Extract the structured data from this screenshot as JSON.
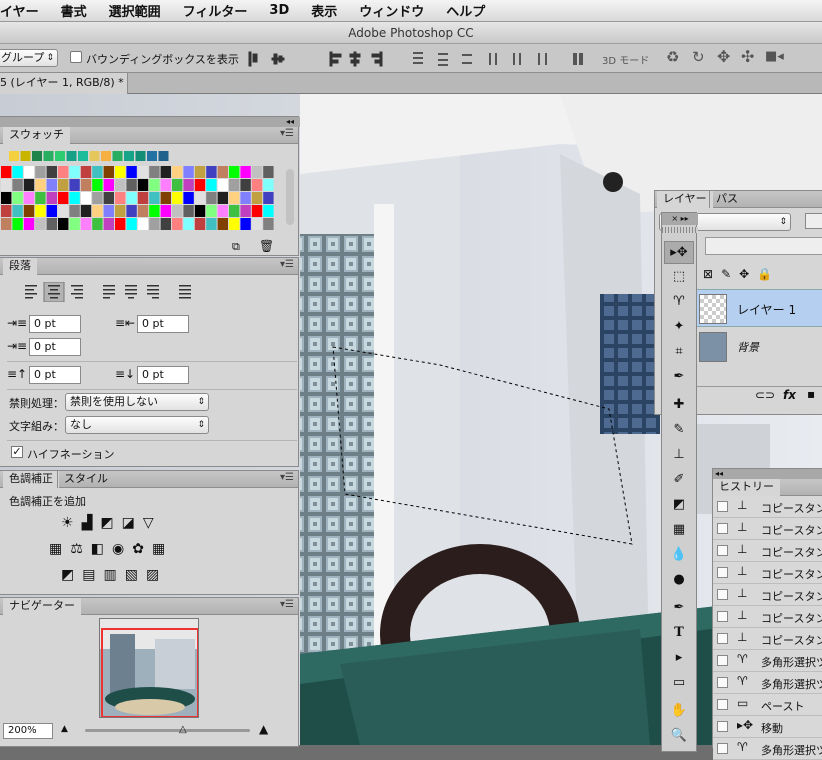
{
  "menubar": {
    "items": [
      "イヤー",
      "書式",
      "選択範囲",
      "フィルター",
      "3D",
      "表示",
      "ウィンドウ",
      "ヘルプ"
    ]
  },
  "window": {
    "title": "Adobe Photoshop CC"
  },
  "options": {
    "auto_select": "グループ",
    "bbox_label": "バウンディングボックスを表示",
    "mode3d_label": "3D モード"
  },
  "doc": {
    "tab_label": "5 (レイヤー 1, RGB/8) *"
  },
  "swatches": {
    "title": "スウォッチ"
  },
  "paragraph": {
    "title": "段落",
    "indent_left": "0 pt",
    "indent_right": "0 pt",
    "indent_first": "0 pt",
    "space_before": "0 pt",
    "space_after": "0 pt",
    "kinsoku_label": "禁則処理：",
    "kinsoku_value": "禁則を使用しない",
    "mojikumi_label": "文字組み：",
    "mojikumi_value": "なし",
    "hyphenation_label": "ハイフネーション"
  },
  "adjustments": {
    "tab1": "色調補正",
    "tab2": "スタイル",
    "add_label": "色調補正を追加"
  },
  "navigator": {
    "title": "ナビゲーター",
    "zoom": "200%"
  },
  "layers": {
    "tab1": "レイヤー",
    "tab2": "パス",
    "items": [
      {
        "name": "レイヤー 1"
      },
      {
        "name": "背景"
      }
    ]
  },
  "history": {
    "title": "ヒストリー",
    "items": [
      {
        "label": "コピースタン",
        "icon": "stamp-icon"
      },
      {
        "label": "コピースタン",
        "icon": "stamp-icon"
      },
      {
        "label": "コピースタン",
        "icon": "stamp-icon"
      },
      {
        "label": "コピースタン",
        "icon": "stamp-icon"
      },
      {
        "label": "コピースタン",
        "icon": "stamp-icon"
      },
      {
        "label": "コピースタン",
        "icon": "stamp-icon"
      },
      {
        "label": "コピースタン",
        "icon": "stamp-icon"
      },
      {
        "label": "多角形選択ツ",
        "icon": "lasso-icon"
      },
      {
        "label": "多角形選択ツ",
        "icon": "lasso-icon"
      },
      {
        "label": "ペースト",
        "icon": "paste-icon"
      },
      {
        "label": "移動",
        "icon": "move-icon"
      },
      {
        "label": "多角形選択ツ",
        "icon": "lasso-icon"
      }
    ]
  },
  "colors": {
    "accent": "#a8c6ec",
    "selected_row": "#b5cff0"
  }
}
